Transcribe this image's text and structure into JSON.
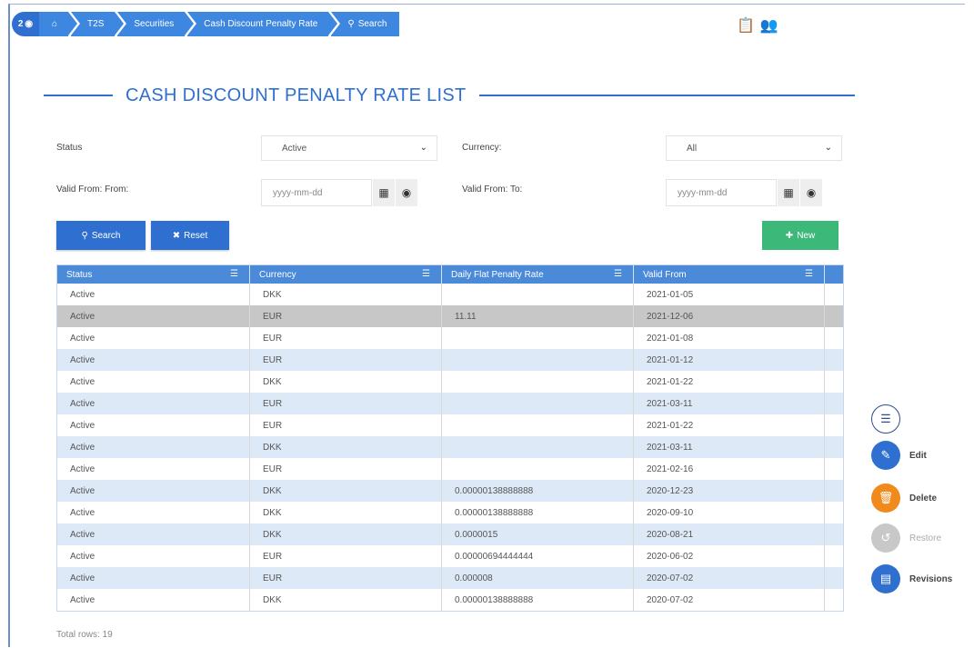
{
  "breadcrumb": {
    "home_badge": "2",
    "items": [
      "T2S",
      "Securities",
      "Cash Discount Penalty Rate",
      "Search"
    ]
  },
  "page": {
    "title": "CASH DISCOUNT PENALTY RATE LIST"
  },
  "filters": {
    "status_label": "Status",
    "status_value": "Active",
    "currency_label": "Currency:",
    "currency_value": "All",
    "valid_from_from_label": "Valid From: From:",
    "valid_from_to_label": "Valid From: To:",
    "date_placeholder": "yyyy-mm-dd"
  },
  "buttons": {
    "search": "Search",
    "reset": "Reset",
    "new": "New"
  },
  "table": {
    "columns": [
      "Status",
      "Currency",
      "Daily Flat Penalty Rate",
      "Valid From"
    ],
    "rows": [
      [
        "Active",
        "DKK",
        "",
        "2021-01-05"
      ],
      [
        "Active",
        "EUR",
        "11.11",
        "2021-12-06"
      ],
      [
        "Active",
        "EUR",
        "",
        "2021-01-08"
      ],
      [
        "Active",
        "EUR",
        "",
        "2021-01-12"
      ],
      [
        "Active",
        "DKK",
        "",
        "2021-01-22"
      ],
      [
        "Active",
        "EUR",
        "",
        "2021-03-11"
      ],
      [
        "Active",
        "EUR",
        "",
        "2021-01-22"
      ],
      [
        "Active",
        "DKK",
        "",
        "2021-03-11"
      ],
      [
        "Active",
        "EUR",
        "",
        "2021-02-16"
      ],
      [
        "Active",
        "DKK",
        "0.00000138888888",
        "2020-12-23"
      ],
      [
        "Active",
        "DKK",
        "0.00000138888888",
        "2020-09-10"
      ],
      [
        "Active",
        "DKK",
        "0.0000015",
        "2020-08-21"
      ],
      [
        "Active",
        "EUR",
        "0.00000694444444",
        "2020-06-02"
      ],
      [
        "Active",
        "EUR",
        "0.000008",
        "2020-07-02"
      ],
      [
        "Active",
        "DKK",
        "0.00000138888888",
        "2020-07-02"
      ]
    ],
    "total_rows": "Total rows: 19"
  },
  "actions": {
    "edit": "Edit",
    "delete": "Delete",
    "restore": "Restore",
    "revisions": "Revisions"
  },
  "colors": {
    "primary": "#2f6fcf",
    "header": "#4b8ad8",
    "new": "#3cb878",
    "delete": "#f08a1c",
    "restore": "#c8c8c8"
  }
}
